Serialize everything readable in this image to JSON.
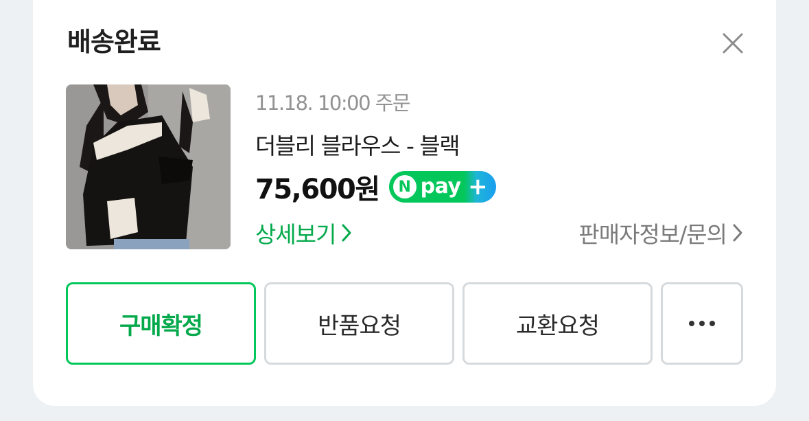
{
  "header": {
    "status_title": "배송완료"
  },
  "order": {
    "date_text": "11.18. 10:00 주문",
    "product_name": "더블리 블라우스 - 블랙",
    "price": "75,600원",
    "npay_badge": {
      "n": "N",
      "text": "pay",
      "plus": "+"
    },
    "detail_link": "상세보기",
    "seller_link": "판매자정보/문의"
  },
  "actions": {
    "confirm_label": "구매확정",
    "return_label": "반품요청",
    "exchange_label": "교환요청"
  },
  "colors": {
    "accent": "#03c75a",
    "accent_text": "#03a94b"
  }
}
